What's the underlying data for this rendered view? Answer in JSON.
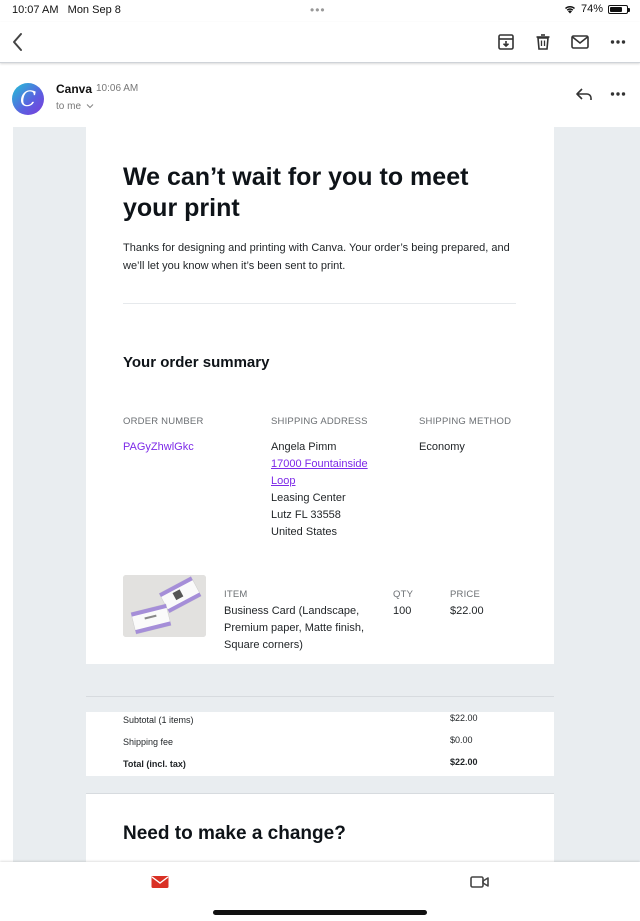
{
  "status_bar": {
    "time": "10:07 AM",
    "date": "Mon Sep 8",
    "battery": "74%",
    "battery_level": 0.74
  },
  "toolbar": {
    "back_label": "",
    "icons": [
      "archive-icon",
      "trash-icon",
      "mail-icon",
      "more-icon"
    ]
  },
  "email": {
    "sender": "Canva",
    "time": "10:06 AM",
    "to": "to me",
    "avatar_letter": "C"
  },
  "content": {
    "headline": "We can’t wait for you to meet your print",
    "intro": "Thanks for designing and printing with Canva. Your order’s being prepared, and we’ll let you know when it’s been sent to print.",
    "summary_title": "Your order summary",
    "order_number_label": "ORDER NUMBER",
    "shipping_address_label": "SHIPPING ADDRESS",
    "shipping_method_label": "SHIPPING METHOD",
    "order_number": "PAGyZhwlGkc",
    "address_name": "Angela Pimm",
    "address_street": "17000 Fountainside Loop",
    "address_line2": "Leasing Center",
    "address_city": "Lutz FL 33558",
    "address_country": "United States",
    "shipping_method": "Economy",
    "item_label": "ITEM",
    "qty_label": "QTY",
    "price_label": "PRICE",
    "item_name": "Business Card (Landscape, Premium paper, Matte finish, Square corners)",
    "qty": "100",
    "price": "$22.00",
    "subtotal_label": "Subtotal (1 items)",
    "subtotal": "$22.00",
    "shipping_fee_label": "Shipping fee",
    "shipping_fee": "$0.00",
    "total_label": "Total (incl. tax)",
    "total": "$22.00",
    "change_title": "Need to make a change?"
  },
  "colors": {
    "accent": "#7d2ae8",
    "mail_red": "#d93025",
    "body_bg": "#e9edf0"
  }
}
